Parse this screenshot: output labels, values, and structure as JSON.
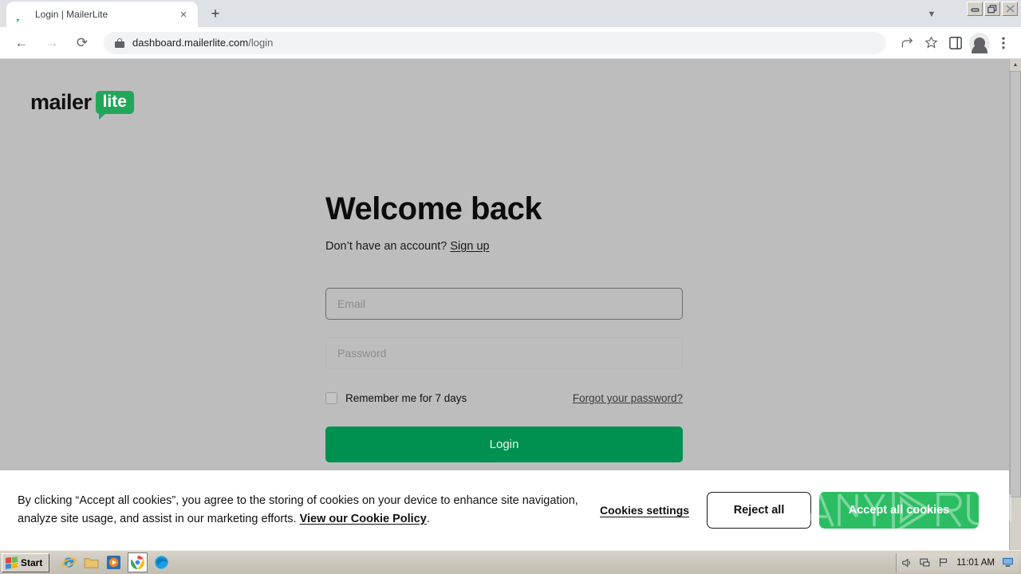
{
  "browser": {
    "tab": {
      "title": "Login | MailerLite",
      "favicon": "speech-bubble-icon",
      "close": "×"
    },
    "new_tab_label": "+",
    "tabstrip_caret": "▼",
    "window_controls": {
      "minimize": "–",
      "restore": "❐",
      "close": "✕"
    },
    "nav": {
      "back": "←",
      "forward": "→",
      "reload": "⟳"
    },
    "omnibox": {
      "lock": "lock-icon",
      "host": "dashboard.mailerlite.com",
      "path": "/login",
      "full_url": "dashboard.mailerlite.com/login"
    },
    "toolbar_icons": [
      "share-icon",
      "bookmark-star-icon",
      "side-panel-icon",
      "profile-avatar-icon",
      "three-dot-menu-icon"
    ]
  },
  "page": {
    "background_color": "#bdbdbd",
    "logo": {
      "word": "mailer",
      "badge": "lite",
      "badge_color": "#22a65a"
    },
    "heading": "Welcome back",
    "subtext_prefix": "Don’t have an account? ",
    "signup_link": "Sign up",
    "email": {
      "placeholder": "Email",
      "value": ""
    },
    "password": {
      "placeholder": "Password",
      "value": ""
    },
    "remember_label": "Remember me for 7 days",
    "remember_checked": false,
    "forgot_link": "Forgot your password?",
    "login_button": "Login",
    "login_button_color": "#009150"
  },
  "cookie_banner": {
    "text_line1": "By clicking “Accept all cookies”, you agree to the storing of cookies on your device to enhance",
    "text_line2": "site navigation, analyze site usage, and assist in our marketing efforts. ",
    "policy_link": "View our Cookie Policy",
    "policy_period": ".",
    "settings_link": "Cookies settings",
    "reject_button": "Reject all",
    "accept_button": "Accept all cookies",
    "accept_color": "#2cbd63"
  },
  "taskbar": {
    "start_label": "Start",
    "quick_launch": [
      "internet-explorer-icon",
      "folder-icon",
      "media-player-icon",
      "chrome-icon",
      "edge-icon"
    ],
    "tray_icons": [
      "volume-icon",
      "network-icon",
      "flag-icon",
      "monitor-icon"
    ],
    "clock": "11:01 AM"
  },
  "watermark": {
    "text": "ANY.RUN"
  }
}
